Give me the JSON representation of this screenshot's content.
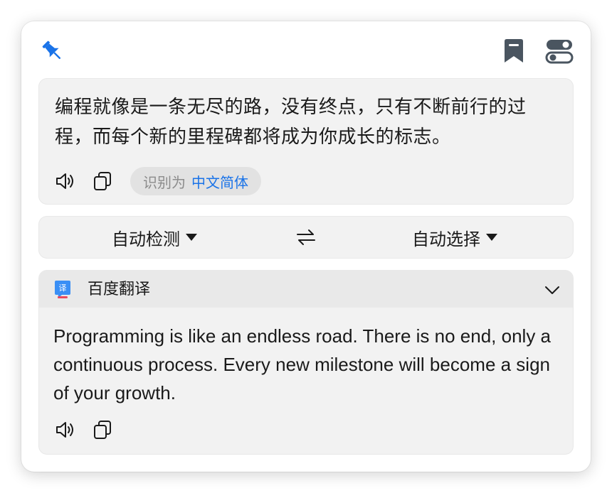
{
  "source": {
    "text": "编程就像是一条无尽的路，没有终点，只有不断前行的过程，而每个新的里程碑都将成为你成长的标志。",
    "detected_prefix": "识别为",
    "detected_lang": "中文简体"
  },
  "languages": {
    "from": "自动检测",
    "to": "自动选择"
  },
  "result": {
    "service_name": "百度翻译",
    "text": "Programming is like an endless road. There is no end, only a continuous process. Every new milestone will become a sign of your growth."
  },
  "icons": {
    "pin": "pin-icon",
    "bookmark": "bookmark-icon",
    "settings": "toggle-settings-icon",
    "speak": "speaker-icon",
    "copy": "copy-icon",
    "swap": "swap-icon",
    "collapse": "chevron-down-icon"
  },
  "colors": {
    "accent": "#1a73e8",
    "card_bg": "#f2f2f2",
    "header_bg": "#e9e9e9",
    "icon": "#4a5560"
  }
}
